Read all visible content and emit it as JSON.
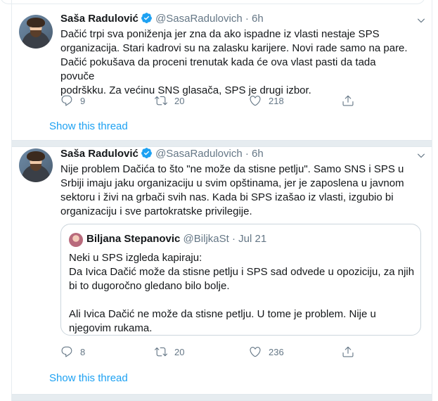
{
  "colors": {
    "accent": "#1da1f2",
    "secondary_text": "#657786",
    "border": "#e6ecf0",
    "text": "#14171a"
  },
  "tweets": [
    {
      "author": {
        "name": "Saša Radulović",
        "handle": "@SasaRadulovich",
        "verified": true
      },
      "time": "6h",
      "lines": [
        "Dačić trpi sva poniženja jer zna da ako ispadne iz vlasti nestaje SPS",
        "organizacija. Stari kadrovi su na zalasku karijere. Novi rade samo na pare.",
        "Dačić pokušava da proceni trenutak kada će ova vlast pasti da tada povuče",
        "podrškku. Za većinu SNS glasača, SPS je drugi izbor."
      ],
      "stats": {
        "replies": "9",
        "retweets": "20",
        "likes": "218"
      },
      "show_thread": "Show this thread"
    },
    {
      "author": {
        "name": "Saša Radulović",
        "handle": "@SasaRadulovich",
        "verified": true
      },
      "time": "6h",
      "lines": [
        "Nije problem Dačića to što \"ne može da stisne petlju\". Samo SNS i SPS u",
        "Srbiji imaju jaku organizaciju u svim opštinama, jer je zaposlena u javnom",
        "sektoru i živi na grbači svih nas. Kada bi SPS izašao iz vlasti, izgubio bi",
        "organizaciju i sve partokratske privilegije."
      ],
      "quote": {
        "author": {
          "name": "Biljana Stepanovic",
          "handle": "@BiljkaSt"
        },
        "time": "Jul 21",
        "lines": [
          "Neki u SPS izgleda kapiraju:",
          "Da Ivica Dačić može da stisne petlju i SPS sad odvede u opoziciju, za njih",
          "bi to dugoročno gledano bilo bolje.",
          "",
          "Ali Ivica Dačić ne može da stisne petlju. U tome je problem. Nije u",
          "njegovim rukama."
        ]
      },
      "stats": {
        "replies": "8",
        "retweets": "20",
        "likes": "236"
      },
      "show_thread": "Show this thread"
    }
  ]
}
